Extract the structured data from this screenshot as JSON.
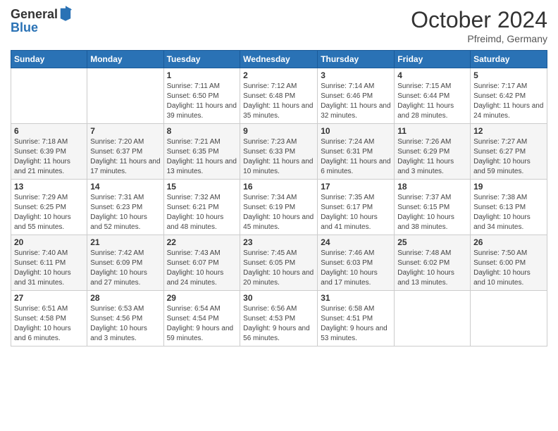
{
  "logo": {
    "general": "General",
    "blue": "Blue"
  },
  "title": "October 2024",
  "subtitle": "Pfreimd, Germany",
  "days_of_week": [
    "Sunday",
    "Monday",
    "Tuesday",
    "Wednesday",
    "Thursday",
    "Friday",
    "Saturday"
  ],
  "weeks": [
    [
      {
        "day": "",
        "info": ""
      },
      {
        "day": "",
        "info": ""
      },
      {
        "day": "1",
        "info": "Sunrise: 7:11 AM\nSunset: 6:50 PM\nDaylight: 11 hours and 39 minutes."
      },
      {
        "day": "2",
        "info": "Sunrise: 7:12 AM\nSunset: 6:48 PM\nDaylight: 11 hours and 35 minutes."
      },
      {
        "day": "3",
        "info": "Sunrise: 7:14 AM\nSunset: 6:46 PM\nDaylight: 11 hours and 32 minutes."
      },
      {
        "day": "4",
        "info": "Sunrise: 7:15 AM\nSunset: 6:44 PM\nDaylight: 11 hours and 28 minutes."
      },
      {
        "day": "5",
        "info": "Sunrise: 7:17 AM\nSunset: 6:42 PM\nDaylight: 11 hours and 24 minutes."
      }
    ],
    [
      {
        "day": "6",
        "info": "Sunrise: 7:18 AM\nSunset: 6:39 PM\nDaylight: 11 hours and 21 minutes."
      },
      {
        "day": "7",
        "info": "Sunrise: 7:20 AM\nSunset: 6:37 PM\nDaylight: 11 hours and 17 minutes."
      },
      {
        "day": "8",
        "info": "Sunrise: 7:21 AM\nSunset: 6:35 PM\nDaylight: 11 hours and 13 minutes."
      },
      {
        "day": "9",
        "info": "Sunrise: 7:23 AM\nSunset: 6:33 PM\nDaylight: 11 hours and 10 minutes."
      },
      {
        "day": "10",
        "info": "Sunrise: 7:24 AM\nSunset: 6:31 PM\nDaylight: 11 hours and 6 minutes."
      },
      {
        "day": "11",
        "info": "Sunrise: 7:26 AM\nSunset: 6:29 PM\nDaylight: 11 hours and 3 minutes."
      },
      {
        "day": "12",
        "info": "Sunrise: 7:27 AM\nSunset: 6:27 PM\nDaylight: 10 hours and 59 minutes."
      }
    ],
    [
      {
        "day": "13",
        "info": "Sunrise: 7:29 AM\nSunset: 6:25 PM\nDaylight: 10 hours and 55 minutes."
      },
      {
        "day": "14",
        "info": "Sunrise: 7:31 AM\nSunset: 6:23 PM\nDaylight: 10 hours and 52 minutes."
      },
      {
        "day": "15",
        "info": "Sunrise: 7:32 AM\nSunset: 6:21 PM\nDaylight: 10 hours and 48 minutes."
      },
      {
        "day": "16",
        "info": "Sunrise: 7:34 AM\nSunset: 6:19 PM\nDaylight: 10 hours and 45 minutes."
      },
      {
        "day": "17",
        "info": "Sunrise: 7:35 AM\nSunset: 6:17 PM\nDaylight: 10 hours and 41 minutes."
      },
      {
        "day": "18",
        "info": "Sunrise: 7:37 AM\nSunset: 6:15 PM\nDaylight: 10 hours and 38 minutes."
      },
      {
        "day": "19",
        "info": "Sunrise: 7:38 AM\nSunset: 6:13 PM\nDaylight: 10 hours and 34 minutes."
      }
    ],
    [
      {
        "day": "20",
        "info": "Sunrise: 7:40 AM\nSunset: 6:11 PM\nDaylight: 10 hours and 31 minutes."
      },
      {
        "day": "21",
        "info": "Sunrise: 7:42 AM\nSunset: 6:09 PM\nDaylight: 10 hours and 27 minutes."
      },
      {
        "day": "22",
        "info": "Sunrise: 7:43 AM\nSunset: 6:07 PM\nDaylight: 10 hours and 24 minutes."
      },
      {
        "day": "23",
        "info": "Sunrise: 7:45 AM\nSunset: 6:05 PM\nDaylight: 10 hours and 20 minutes."
      },
      {
        "day": "24",
        "info": "Sunrise: 7:46 AM\nSunset: 6:03 PM\nDaylight: 10 hours and 17 minutes."
      },
      {
        "day": "25",
        "info": "Sunrise: 7:48 AM\nSunset: 6:02 PM\nDaylight: 10 hours and 13 minutes."
      },
      {
        "day": "26",
        "info": "Sunrise: 7:50 AM\nSunset: 6:00 PM\nDaylight: 10 hours and 10 minutes."
      }
    ],
    [
      {
        "day": "27",
        "info": "Sunrise: 6:51 AM\nSunset: 4:58 PM\nDaylight: 10 hours and 6 minutes."
      },
      {
        "day": "28",
        "info": "Sunrise: 6:53 AM\nSunset: 4:56 PM\nDaylight: 10 hours and 3 minutes."
      },
      {
        "day": "29",
        "info": "Sunrise: 6:54 AM\nSunset: 4:54 PM\nDaylight: 9 hours and 59 minutes."
      },
      {
        "day": "30",
        "info": "Sunrise: 6:56 AM\nSunset: 4:53 PM\nDaylight: 9 hours and 56 minutes."
      },
      {
        "day": "31",
        "info": "Sunrise: 6:58 AM\nSunset: 4:51 PM\nDaylight: 9 hours and 53 minutes."
      },
      {
        "day": "",
        "info": ""
      },
      {
        "day": "",
        "info": ""
      }
    ]
  ]
}
